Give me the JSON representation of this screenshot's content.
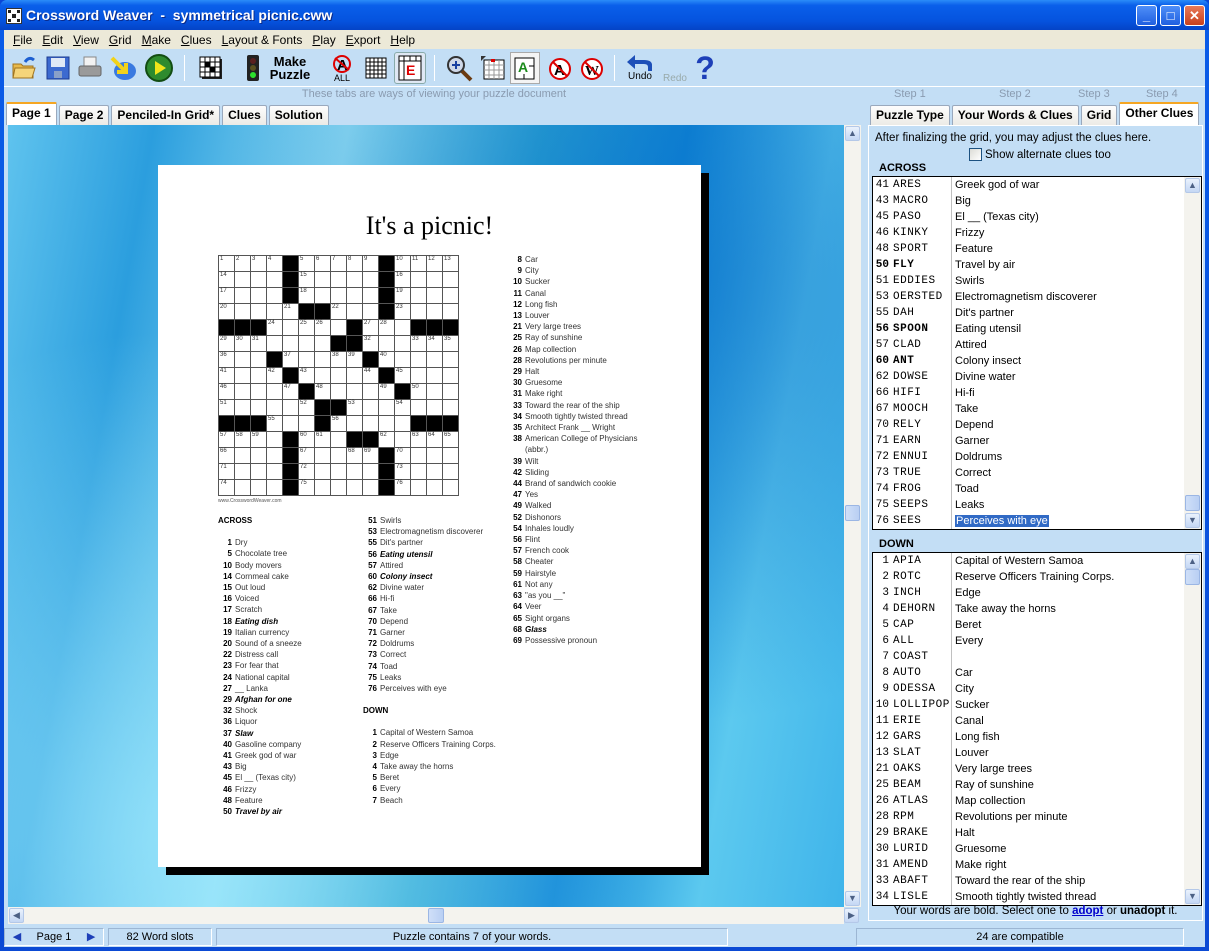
{
  "window": {
    "title": "Crossword Weaver  -  symmetrical picnic.cww",
    "controls": {
      "minimize": "_",
      "maximize": "□",
      "close": "✕"
    }
  },
  "menu": [
    "File",
    "Edit",
    "View",
    "Grid",
    "Make",
    "Clues",
    "Layout & Fonts",
    "Play",
    "Export",
    "Help"
  ],
  "toolbar": {
    "icons": [
      "open-folder-icon",
      "save-disk-icon",
      "print-icon",
      "import-arrow-icon",
      "play-icon",
      "grid-pattern-icon",
      "traffic-light-icon",
      "clue-all-icon",
      "grid-icon",
      "edit-grid-icon",
      "zoom-in-icon",
      "grid-select-icon",
      "word-direction-icon",
      "no-letter-icon",
      "no-word-icon",
      "undo-icon",
      "help-icon"
    ],
    "make_puzzle_label": "Make\nPuzzle",
    "all_label": "ALL",
    "undo_label": "Undo",
    "redo_label": "Redo",
    "help_label": "?"
  },
  "view_hint": "These tabs are ways of viewing your puzzle document",
  "view_tabs": [
    {
      "label": "Page 1",
      "active": true
    },
    {
      "label": "Page 2",
      "active": false
    },
    {
      "label": "Penciled-In Grid*",
      "active": false
    },
    {
      "label": "Clues",
      "active": false
    },
    {
      "label": "Solution",
      "active": false
    }
  ],
  "steps": [
    "Step 1",
    "Step 2",
    "Step 3",
    "Step 4"
  ],
  "step_tabs": [
    {
      "label": "Puzzle Type",
      "active": false
    },
    {
      "label": "Your Words & Clues",
      "active": false
    },
    {
      "label": "Grid",
      "active": false
    },
    {
      "label": "Other Clues",
      "active": true
    }
  ],
  "puzzle_page": {
    "title": "It's a picnic!",
    "credit": "www.CrosswordWeaver.com",
    "grid": [
      [
        "1",
        "2",
        "3",
        "4",
        "#",
        "5",
        "6",
        "7",
        "8",
        "9",
        "#",
        "10",
        "11",
        "12",
        "13"
      ],
      [
        "14",
        "",
        "",
        "",
        "#",
        "15",
        "",
        "",
        "",
        "",
        "#",
        "16",
        "",
        "",
        ""
      ],
      [
        "17",
        "",
        "",
        "",
        "#",
        "18",
        "",
        "",
        "",
        "",
        "#",
        "19",
        "",
        "",
        ""
      ],
      [
        "20",
        "",
        "",
        "",
        "21",
        "#",
        "#",
        "22",
        "",
        "",
        "#",
        "23",
        "",
        "",
        ""
      ],
      [
        "#",
        "#",
        "#",
        "24",
        "",
        "25",
        "26",
        "",
        "#",
        "27",
        "28",
        "",
        "#",
        "#",
        "#"
      ],
      [
        "29",
        "30",
        "31",
        "",
        "",
        "",
        "",
        "#",
        "#",
        "32",
        "",
        "",
        "33",
        "34",
        "35"
      ],
      [
        "36",
        "",
        "",
        "#",
        "37",
        "",
        "",
        "38",
        "39",
        "#",
        "40",
        "",
        "",
        "",
        ""
      ],
      [
        "41",
        "",
        "",
        "42",
        "#",
        "43",
        "",
        "",
        "",
        "44",
        "#",
        "45",
        "",
        "",
        ""
      ],
      [
        "46",
        "",
        "",
        "",
        "47",
        "#",
        "48",
        "",
        "",
        "",
        "49",
        "#",
        "50",
        "",
        ""
      ],
      [
        "51",
        "",
        "",
        "",
        "",
        "52",
        "#",
        "#",
        "53",
        "",
        "",
        "54",
        "",
        "",
        ""
      ],
      [
        "#",
        "#",
        "#",
        "55",
        "",
        "",
        "#",
        "56",
        "",
        "",
        "",
        "",
        "#",
        "#",
        "#"
      ],
      [
        "57",
        "58",
        "59",
        "",
        "#",
        "60",
        "61",
        "",
        "#",
        "#",
        "62",
        "",
        "63",
        "64",
        "65"
      ],
      [
        "66",
        "",
        "",
        "",
        "#",
        "67",
        "",
        "",
        "68",
        "69",
        "#",
        "70",
        "",
        "",
        ""
      ],
      [
        "71",
        "",
        "",
        "",
        "#",
        "72",
        "",
        "",
        "",
        "",
        "#",
        "73",
        "",
        "",
        ""
      ],
      [
        "74",
        "",
        "",
        "",
        "#",
        "75",
        "",
        "",
        "",
        "",
        "#",
        "76",
        "",
        "",
        ""
      ]
    ],
    "across_heading": "ACROSS",
    "down_heading": "DOWN",
    "across_col1": [
      {
        "n": "1",
        "t": "Dry",
        "b": false
      },
      {
        "n": "5",
        "t": "Chocolate tree",
        "b": false
      },
      {
        "n": "10",
        "t": "Body movers",
        "b": false
      },
      {
        "n": "14",
        "t": "Cornmeal cake",
        "b": false
      },
      {
        "n": "15",
        "t": "Out loud",
        "b": false
      },
      {
        "n": "16",
        "t": "Voiced",
        "b": false
      },
      {
        "n": "17",
        "t": "Scratch",
        "b": false
      },
      {
        "n": "18",
        "t": "Eating dish",
        "b": true
      },
      {
        "n": "19",
        "t": "Italian currency",
        "b": false
      },
      {
        "n": "20",
        "t": "Sound of a sneeze",
        "b": false
      },
      {
        "n": "22",
        "t": "Distress call",
        "b": false
      },
      {
        "n": "23",
        "t": "For fear that",
        "b": false
      },
      {
        "n": "24",
        "t": "National capital",
        "b": false
      },
      {
        "n": "27",
        "t": "__ Lanka",
        "b": false
      },
      {
        "n": "29",
        "t": "Afghan for one",
        "b": true
      },
      {
        "n": "32",
        "t": "Shock",
        "b": false
      },
      {
        "n": "36",
        "t": "Liquor",
        "b": false
      },
      {
        "n": "37",
        "t": "Slaw",
        "b": true
      },
      {
        "n": "40",
        "t": "Gasoline company",
        "b": false
      },
      {
        "n": "41",
        "t": "Greek god of war",
        "b": false
      },
      {
        "n": "43",
        "t": "Big",
        "b": false
      },
      {
        "n": "45",
        "t": "El __ (Texas city)",
        "b": false
      },
      {
        "n": "46",
        "t": "Frizzy",
        "b": false
      },
      {
        "n": "48",
        "t": "Feature",
        "b": false
      },
      {
        "n": "50",
        "t": "Travel by air",
        "b": true
      }
    ],
    "across_col2": [
      {
        "n": "51",
        "t": "Swirls",
        "b": false
      },
      {
        "n": "53",
        "t": "Electromagnetism discoverer",
        "b": false
      },
      {
        "n": "55",
        "t": "Dit's partner",
        "b": false
      },
      {
        "n": "56",
        "t": "Eating utensil",
        "b": true
      },
      {
        "n": "57",
        "t": "Attired",
        "b": false
      },
      {
        "n": "60",
        "t": "Colony insect",
        "b": true
      },
      {
        "n": "62",
        "t": "Divine water",
        "b": false
      },
      {
        "n": "66",
        "t": "Hi-fi",
        "b": false
      },
      {
        "n": "67",
        "t": "Take",
        "b": false
      },
      {
        "n": "70",
        "t": "Depend",
        "b": false
      },
      {
        "n": "71",
        "t": "Garner",
        "b": false
      },
      {
        "n": "72",
        "t": "Doldrums",
        "b": false
      },
      {
        "n": "73",
        "t": "Correct",
        "b": false
      },
      {
        "n": "74",
        "t": "Toad",
        "b": false
      },
      {
        "n": "75",
        "t": "Leaks",
        "b": false
      },
      {
        "n": "76",
        "t": "Perceives with eye",
        "b": false
      }
    ],
    "down_col2": [
      {
        "n": "1",
        "t": "Capital of Western Samoa",
        "b": false
      },
      {
        "n": "2",
        "t": "Reserve Officers Training Corps.",
        "b": false
      },
      {
        "n": "3",
        "t": "Edge",
        "b": false
      },
      {
        "n": "4",
        "t": "Take away the horns",
        "b": false
      },
      {
        "n": "5",
        "t": "Beret",
        "b": false
      },
      {
        "n": "6",
        "t": "Every",
        "b": false
      },
      {
        "n": "7",
        "t": "Beach",
        "b": false
      }
    ],
    "down_col3": [
      {
        "n": "8",
        "t": "Car",
        "b": false
      },
      {
        "n": "9",
        "t": "City",
        "b": false
      },
      {
        "n": "10",
        "t": "Sucker",
        "b": false
      },
      {
        "n": "11",
        "t": "Canal",
        "b": false
      },
      {
        "n": "12",
        "t": "Long fish",
        "b": false
      },
      {
        "n": "13",
        "t": "Louver",
        "b": false
      },
      {
        "n": "21",
        "t": "Very large trees",
        "b": false
      },
      {
        "n": "25",
        "t": "Ray of sunshine",
        "b": false
      },
      {
        "n": "26",
        "t": "Map collection",
        "b": false
      },
      {
        "n": "28",
        "t": "Revolutions per minute",
        "b": false
      },
      {
        "n": "29",
        "t": "Halt",
        "b": false
      },
      {
        "n": "30",
        "t": "Gruesome",
        "b": false
      },
      {
        "n": "31",
        "t": "Make right",
        "b": false
      },
      {
        "n": "33",
        "t": "Toward the rear of the ship",
        "b": false
      },
      {
        "n": "34",
        "t": "Smooth tightly twisted thread",
        "b": false
      },
      {
        "n": "35",
        "t": "Architect Frank __ Wright",
        "b": false
      },
      {
        "n": "38",
        "t": "American College of Physicians (abbr.)",
        "b": false
      },
      {
        "n": "39",
        "t": "Wilt",
        "b": false
      },
      {
        "n": "42",
        "t": "Sliding",
        "b": false
      },
      {
        "n": "44",
        "t": "Brand of sandwich cookie",
        "b": false
      },
      {
        "n": "47",
        "t": "Yes",
        "b": false
      },
      {
        "n": "49",
        "t": "Walked",
        "b": false
      },
      {
        "n": "52",
        "t": "Dishonors",
        "b": false
      },
      {
        "n": "54",
        "t": "Inhales loudly",
        "b": false
      },
      {
        "n": "56",
        "t": "Flint",
        "b": false
      },
      {
        "n": "57",
        "t": "French cook",
        "b": false
      },
      {
        "n": "58",
        "t": "Cheater",
        "b": false
      },
      {
        "n": "59",
        "t": "Hairstyle",
        "b": false
      },
      {
        "n": "61",
        "t": "Not any",
        "b": false
      },
      {
        "n": "63",
        "t": "\"as you __\"",
        "b": false
      },
      {
        "n": "64",
        "t": "Veer",
        "b": false
      },
      {
        "n": "65",
        "t": "Sight organs",
        "b": false
      },
      {
        "n": "68",
        "t": "Glass",
        "b": true
      },
      {
        "n": "69",
        "t": "Possessive pronoun",
        "b": false
      }
    ]
  },
  "right_panel": {
    "hint": "After finalizing the grid, you may adjust the clues here.",
    "alt_clues_label": "Show alternate clues too",
    "alt_clues_checked": false,
    "across_heading": "ACROSS",
    "down_heading": "DOWN",
    "across": [
      {
        "n": "41",
        "w": "ARES",
        "c": "Greek god of war",
        "b": false
      },
      {
        "n": "43",
        "w": "MACRO",
        "c": "Big",
        "b": false
      },
      {
        "n": "45",
        "w": "PASO",
        "c": "El __ (Texas city)",
        "b": false
      },
      {
        "n": "46",
        "w": "KINKY",
        "c": "Frizzy",
        "b": false
      },
      {
        "n": "48",
        "w": "SPORT",
        "c": "Feature",
        "b": false
      },
      {
        "n": "50",
        "w": "FLY",
        "c": "Travel by air",
        "b": true
      },
      {
        "n": "51",
        "w": "EDDIES",
        "c": "Swirls",
        "b": false
      },
      {
        "n": "53",
        "w": "OERSTED",
        "c": "Electromagnetism discoverer",
        "b": false
      },
      {
        "n": "55",
        "w": "DAH",
        "c": "Dit's partner",
        "b": false
      },
      {
        "n": "56",
        "w": "SPOON",
        "c": "Eating utensil",
        "b": true
      },
      {
        "n": "57",
        "w": "CLAD",
        "c": "Attired",
        "b": false
      },
      {
        "n": "60",
        "w": "ANT",
        "c": "Colony insect",
        "b": true
      },
      {
        "n": "62",
        "w": "DOWSE",
        "c": "Divine water",
        "b": false
      },
      {
        "n": "66",
        "w": "HIFI",
        "c": "Hi-fi",
        "b": false
      },
      {
        "n": "67",
        "w": "MOOCH",
        "c": "Take",
        "b": false
      },
      {
        "n": "70",
        "w": "RELY",
        "c": "Depend",
        "b": false
      },
      {
        "n": "71",
        "w": "EARN",
        "c": "Garner",
        "b": false
      },
      {
        "n": "72",
        "w": "ENNUI",
        "c": "Doldrums",
        "b": false
      },
      {
        "n": "73",
        "w": "TRUE",
        "c": "Correct",
        "b": false
      },
      {
        "n": "74",
        "w": "FROG",
        "c": "Toad",
        "b": false
      },
      {
        "n": "75",
        "w": "SEEPS",
        "c": "Leaks",
        "b": false
      },
      {
        "n": "76",
        "w": "SEES",
        "c": "Perceives with eye",
        "b": false,
        "selected": true
      }
    ],
    "down": [
      {
        "n": "1",
        "w": "APIA",
        "c": "Capital of Western Samoa",
        "b": false
      },
      {
        "n": "2",
        "w": "ROTC",
        "c": "Reserve Officers Training Corps.",
        "b": false
      },
      {
        "n": "3",
        "w": "INCH",
        "c": "Edge",
        "b": false
      },
      {
        "n": "4",
        "w": "DEHORN",
        "c": "Take away the horns",
        "b": false
      },
      {
        "n": "5",
        "w": "CAP",
        "c": "Beret",
        "b": false
      },
      {
        "n": "6",
        "w": "ALL",
        "c": "Every",
        "b": false
      },
      {
        "n": "7",
        "w": "COAST",
        "c": "",
        "b": false
      },
      {
        "n": "8",
        "w": "AUTO",
        "c": "Car",
        "b": false
      },
      {
        "n": "9",
        "w": "ODESSA",
        "c": "City",
        "b": false
      },
      {
        "n": "10",
        "w": "LOLLIPOP",
        "c": "Sucker",
        "b": false
      },
      {
        "n": "11",
        "w": "ERIE",
        "c": "Canal",
        "b": false
      },
      {
        "n": "12",
        "w": "GARS",
        "c": "Long fish",
        "b": false
      },
      {
        "n": "13",
        "w": "SLAT",
        "c": "Louver",
        "b": false
      },
      {
        "n": "21",
        "w": "OAKS",
        "c": "Very large trees",
        "b": false
      },
      {
        "n": "25",
        "w": "BEAM",
        "c": "Ray of sunshine",
        "b": false
      },
      {
        "n": "26",
        "w": "ATLAS",
        "c": "Map collection",
        "b": false
      },
      {
        "n": "28",
        "w": "RPM",
        "c": "Revolutions per minute",
        "b": false
      },
      {
        "n": "29",
        "w": "BRAKE",
        "c": "Halt",
        "b": false
      },
      {
        "n": "30",
        "w": "LURID",
        "c": "Gruesome",
        "b": false
      },
      {
        "n": "31",
        "w": "AMEND",
        "c": "Make right",
        "b": false
      },
      {
        "n": "33",
        "w": "ABAFT",
        "c": "Toward the rear of the ship",
        "b": false
      },
      {
        "n": "34",
        "w": "LISLE",
        "c": "Smooth tightly twisted thread",
        "b": false
      }
    ],
    "footer_pre": "Your words are bold. Select one to ",
    "footer_adopt": "adopt",
    "footer_mid": " or ",
    "footer_unadopt": "unadopt",
    "footer_post": " it."
  },
  "status": {
    "page": "Page 1",
    "word_slots": "82 Word slots",
    "your_words": "Puzzle contains 7 of your words.",
    "compatible": "24 are compatible"
  },
  "colors": {
    "selection": "#316ac5",
    "panel": "#c3def5",
    "active_tab_accent": "#f5a623",
    "link": "#0000cc"
  }
}
